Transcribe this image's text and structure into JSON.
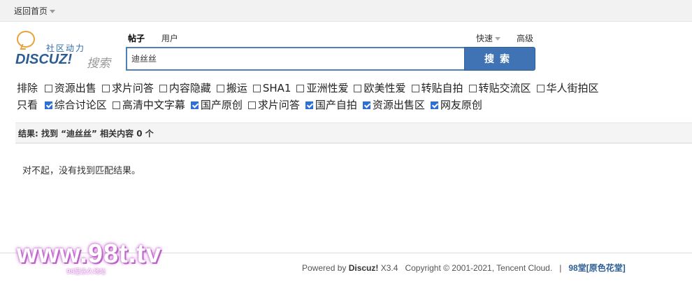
{
  "topbar": {
    "home_label": "返回首页"
  },
  "logo": {
    "slogan": "社区动力",
    "brand": "DISCUZ!",
    "word": "搜索"
  },
  "search": {
    "tabs": [
      "帖子",
      "用户"
    ],
    "quick_label": "快速",
    "advanced_label": "高级",
    "query": "迪丝丝",
    "button_label": "搜索"
  },
  "filters": {
    "exclude_label": "排除",
    "exclude": [
      {
        "label": "资源出售",
        "checked": false
      },
      {
        "label": "求片问答",
        "checked": false
      },
      {
        "label": "内容隐藏",
        "checked": false
      },
      {
        "label": "搬运",
        "checked": false
      },
      {
        "label": "SHA1",
        "checked": false
      },
      {
        "label": "亚洲性爱",
        "checked": false
      },
      {
        "label": "欧美性爱",
        "checked": false
      },
      {
        "label": "转贴自拍",
        "checked": false
      },
      {
        "label": "转贴交流区",
        "checked": false
      },
      {
        "label": "华人街拍区",
        "checked": false
      }
    ],
    "only_label": "只看",
    "only": [
      {
        "label": "综合讨论区",
        "checked": true
      },
      {
        "label": "高清中文字幕",
        "checked": false
      },
      {
        "label": "国产原创",
        "checked": true
      },
      {
        "label": "求片问答",
        "checked": false
      },
      {
        "label": "国产自拍",
        "checked": true
      },
      {
        "label": "资源出售区",
        "checked": true
      },
      {
        "label": "网友原创",
        "checked": true
      }
    ]
  },
  "results": {
    "summary": "结果: 找到 “迪丝丝” 相关内容 0 个",
    "empty_message": "对不起，没有找到匹配结果。"
  },
  "watermark": {
    "text": "www.98t.tv",
    "sub": "98堂永久地址"
  },
  "footer": {
    "powered_prefix": "Powered by ",
    "powered_brand": "Discuz!",
    "version": " X3.4",
    "copyright": "Copyright © 2001-2021, Tencent Cloud.",
    "separator": "|",
    "site": "98堂[原色花堂]"
  }
}
